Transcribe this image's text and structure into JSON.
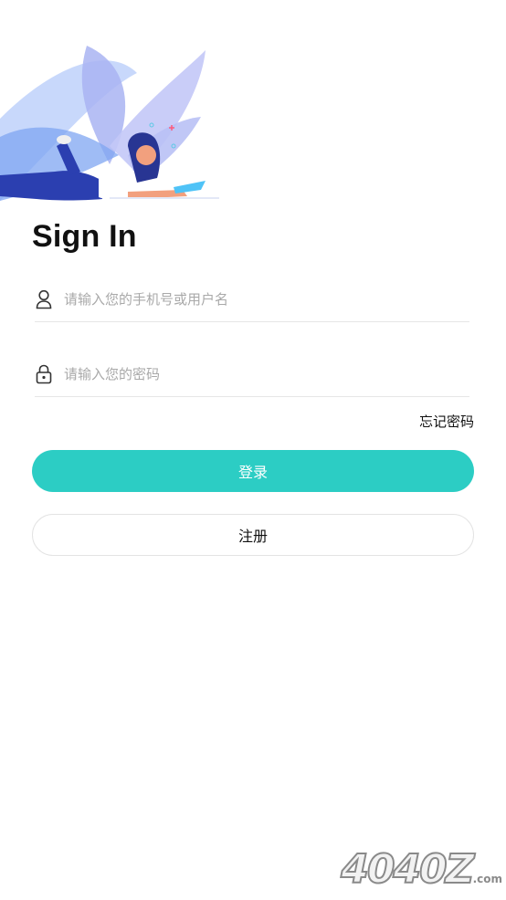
{
  "header": {
    "title": "Sign In"
  },
  "form": {
    "username_placeholder": "请输入您的手机号或用户名",
    "password_placeholder": "请输入您的密码",
    "forgot_label": "忘记密码"
  },
  "buttons": {
    "login_label": "登录",
    "register_label": "注册"
  },
  "icons": {
    "username": "user-icon",
    "password": "lock-icon"
  },
  "colors": {
    "accent": "#2ccdc4",
    "placeholder": "#a9a9a9"
  },
  "watermark": {
    "text": "4040Z",
    "suffix": ".com"
  }
}
